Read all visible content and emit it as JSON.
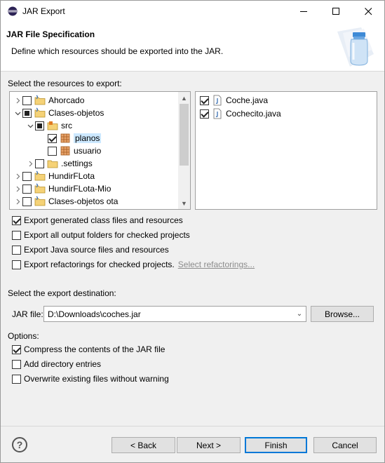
{
  "window": {
    "title": "JAR Export"
  },
  "header": {
    "title": "JAR File Specification",
    "description": "Define which resources should be exported into the JAR."
  },
  "resources": {
    "label": "Select the resources to export:",
    "tree": [
      {
        "label": "Ahorcado",
        "indent": 0,
        "arrow": "collapsed",
        "check": "unchecked",
        "icon": "java-project-icon"
      },
      {
        "label": "Clases-objetos",
        "indent": 0,
        "arrow": "expanded",
        "check": "partial",
        "icon": "java-project-icon"
      },
      {
        "label": "src",
        "indent": 1,
        "arrow": "expanded",
        "check": "partial",
        "icon": "source-folder-icon"
      },
      {
        "label": "planos",
        "indent": 2,
        "arrow": "none",
        "check": "checked",
        "icon": "package-icon",
        "selected": true
      },
      {
        "label": "usuario",
        "indent": 2,
        "arrow": "none",
        "check": "unchecked",
        "icon": "package-icon"
      },
      {
        "label": ".settings",
        "indent": 1,
        "arrow": "collapsed",
        "check": "unchecked",
        "icon": "folder-icon"
      },
      {
        "label": "HundirFLota",
        "indent": 0,
        "arrow": "collapsed",
        "check": "unchecked",
        "icon": "java-project-icon"
      },
      {
        "label": "HundirFLota-Mio",
        "indent": 0,
        "arrow": "collapsed",
        "check": "unchecked",
        "icon": "java-project-icon"
      },
      {
        "label": "Clases-objetos ota",
        "indent": 0,
        "arrow": "collapsed",
        "check": "unchecked",
        "icon": "java-project-icon"
      }
    ],
    "files": [
      {
        "label": "Coche.java",
        "check": "checked",
        "icon": "java-file-icon"
      },
      {
        "label": "Cochecito.java",
        "check": "checked",
        "icon": "java-file-icon"
      }
    ]
  },
  "export_options": [
    {
      "label": "Export generated class files and resources",
      "checked": true
    },
    {
      "label": "Export all output folders for checked projects",
      "checked": false
    },
    {
      "label": "Export Java source files and resources",
      "checked": false
    },
    {
      "label": "Export refactorings for checked projects.",
      "checked": false,
      "link": "Select refactorings..."
    }
  ],
  "destination": {
    "label": "Select the export destination:",
    "jar_label": "JAR file:",
    "jar_value": "D:\\Downloads\\coches.jar",
    "browse_label": "Browse..."
  },
  "options": {
    "label": "Options:",
    "items": [
      {
        "label": "Compress the contents of the JAR file",
        "checked": true
      },
      {
        "label": "Add directory entries",
        "checked": false
      },
      {
        "label": "Overwrite existing files without warning",
        "checked": false
      }
    ]
  },
  "buttons": {
    "help": "?",
    "back": "< Back",
    "next": "Next >",
    "finish": "Finish",
    "cancel": "Cancel"
  },
  "colors": {
    "selection": "#cce8ff",
    "default_button_border": "#0078d7"
  }
}
